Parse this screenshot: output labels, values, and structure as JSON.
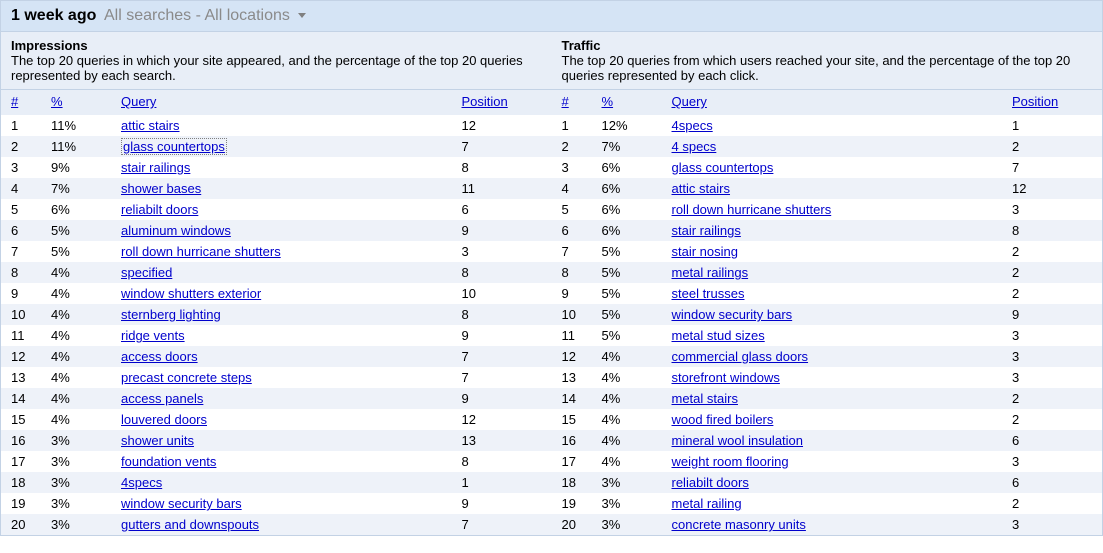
{
  "header": {
    "title": "1 week ago",
    "subtitle": "All searches - All locations"
  },
  "sections": {
    "impressions": {
      "title": "Impressions",
      "desc": "The top 20 queries in which your site appeared, and the percentage of the top 20 queries represented by each search."
    },
    "traffic": {
      "title": "Traffic",
      "desc": "The top 20 queries from which users reached your site, and the percentage of the top 20 queries represented by each click."
    }
  },
  "columns": {
    "num": "#",
    "pct": "%",
    "query": "Query",
    "position": "Position"
  },
  "impressions": [
    {
      "n": "1",
      "pct": "11%",
      "q": "attic stairs",
      "pos": "12",
      "focus": false
    },
    {
      "n": "2",
      "pct": "11%",
      "q": "glass countertops",
      "pos": "7",
      "focus": true
    },
    {
      "n": "3",
      "pct": "9%",
      "q": "stair railings",
      "pos": "8",
      "focus": false
    },
    {
      "n": "4",
      "pct": "7%",
      "q": "shower bases",
      "pos": "11",
      "focus": false
    },
    {
      "n": "5",
      "pct": "6%",
      "q": "reliabilt doors",
      "pos": "6",
      "focus": false
    },
    {
      "n": "6",
      "pct": "5%",
      "q": "aluminum windows",
      "pos": "9",
      "focus": false
    },
    {
      "n": "7",
      "pct": "5%",
      "q": "roll down hurricane shutters",
      "pos": "3",
      "focus": false
    },
    {
      "n": "8",
      "pct": "4%",
      "q": "specified",
      "pos": "8",
      "focus": false
    },
    {
      "n": "9",
      "pct": "4%",
      "q": "window shutters exterior",
      "pos": "10",
      "focus": false
    },
    {
      "n": "10",
      "pct": "4%",
      "q": "sternberg lighting",
      "pos": "8",
      "focus": false
    },
    {
      "n": "11",
      "pct": "4%",
      "q": "ridge vents",
      "pos": "9",
      "focus": false
    },
    {
      "n": "12",
      "pct": "4%",
      "q": "access doors",
      "pos": "7",
      "focus": false
    },
    {
      "n": "13",
      "pct": "4%",
      "q": "precast concrete steps",
      "pos": "7",
      "focus": false
    },
    {
      "n": "14",
      "pct": "4%",
      "q": "access panels",
      "pos": "9",
      "focus": false
    },
    {
      "n": "15",
      "pct": "4%",
      "q": "louvered doors",
      "pos": "12",
      "focus": false
    },
    {
      "n": "16",
      "pct": "3%",
      "q": "shower units",
      "pos": "13",
      "focus": false
    },
    {
      "n": "17",
      "pct": "3%",
      "q": "foundation vents",
      "pos": "8",
      "focus": false
    },
    {
      "n": "18",
      "pct": "3%",
      "q": "4specs",
      "pos": "1",
      "focus": false
    },
    {
      "n": "19",
      "pct": "3%",
      "q": "window security bars",
      "pos": "9",
      "focus": false
    },
    {
      "n": "20",
      "pct": "3%",
      "q": "gutters and downspouts",
      "pos": "7",
      "focus": false
    }
  ],
  "traffic": [
    {
      "n": "1",
      "pct": "12%",
      "q": "4specs",
      "pos": "1"
    },
    {
      "n": "2",
      "pct": "7%",
      "q": "4 specs",
      "pos": "2"
    },
    {
      "n": "3",
      "pct": "6%",
      "q": "glass countertops",
      "pos": "7"
    },
    {
      "n": "4",
      "pct": "6%",
      "q": "attic stairs",
      "pos": "12"
    },
    {
      "n": "5",
      "pct": "6%",
      "q": "roll down hurricane shutters",
      "pos": "3"
    },
    {
      "n": "6",
      "pct": "6%",
      "q": "stair railings",
      "pos": "8"
    },
    {
      "n": "7",
      "pct": "5%",
      "q": "stair nosing",
      "pos": "2"
    },
    {
      "n": "8",
      "pct": "5%",
      "q": "metal railings",
      "pos": "2"
    },
    {
      "n": "9",
      "pct": "5%",
      "q": "steel trusses",
      "pos": "2"
    },
    {
      "n": "10",
      "pct": "5%",
      "q": "window security bars",
      "pos": "9"
    },
    {
      "n": "11",
      "pct": "5%",
      "q": "metal stud sizes",
      "pos": "3"
    },
    {
      "n": "12",
      "pct": "4%",
      "q": "commercial glass doors",
      "pos": "3"
    },
    {
      "n": "13",
      "pct": "4%",
      "q": "storefront windows",
      "pos": "3"
    },
    {
      "n": "14",
      "pct": "4%",
      "q": "metal stairs",
      "pos": "2"
    },
    {
      "n": "15",
      "pct": "4%",
      "q": "wood fired boilers",
      "pos": "2"
    },
    {
      "n": "16",
      "pct": "4%",
      "q": "mineral wool insulation",
      "pos": "6"
    },
    {
      "n": "17",
      "pct": "4%",
      "q": "weight room flooring",
      "pos": "3"
    },
    {
      "n": "18",
      "pct": "3%",
      "q": "reliabilt doors",
      "pos": "6"
    },
    {
      "n": "19",
      "pct": "3%",
      "q": "metal railing",
      "pos": "2"
    },
    {
      "n": "20",
      "pct": "3%",
      "q": "concrete masonry units",
      "pos": "3"
    }
  ]
}
